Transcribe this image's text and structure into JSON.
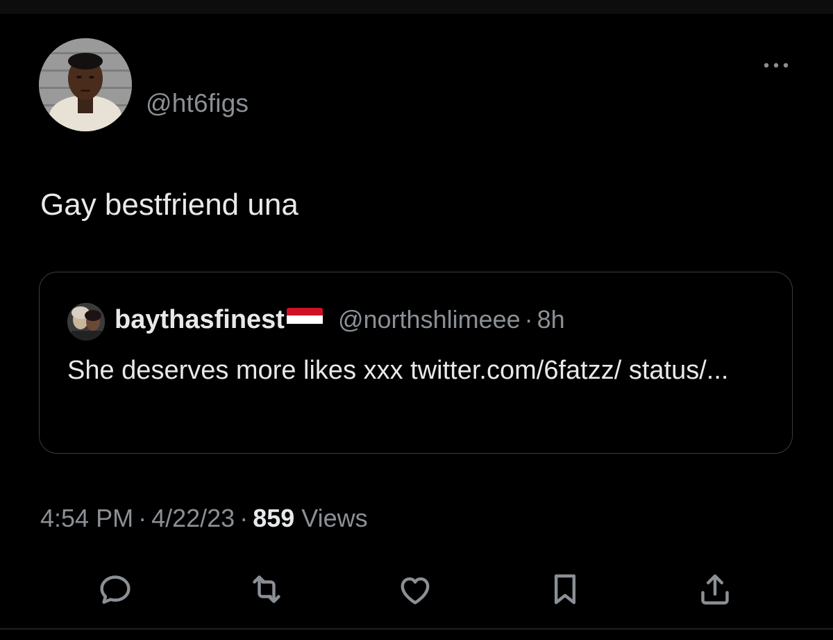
{
  "tweet": {
    "handle": "@ht6figs",
    "text": "Gay bestfriend una",
    "time": "4:54 PM",
    "date": "4/22/23",
    "views_count": "859",
    "views_label": "Views"
  },
  "quoted_tweet": {
    "display_name": "baythasfinest",
    "flag": "yemen-flag",
    "handle": "@northshlimeee",
    "age": "8h",
    "text": "She deserves more likes xxx twitter.com/6fatzz/ status/..."
  },
  "actions": [
    "reply-icon",
    "retweet-icon",
    "like-icon",
    "bookmark-icon",
    "share-icon"
  ],
  "colors": {
    "background": "#000000",
    "text_primary": "#e7e9ea",
    "text_secondary": "#8b9096",
    "border": "#3a3d40"
  }
}
